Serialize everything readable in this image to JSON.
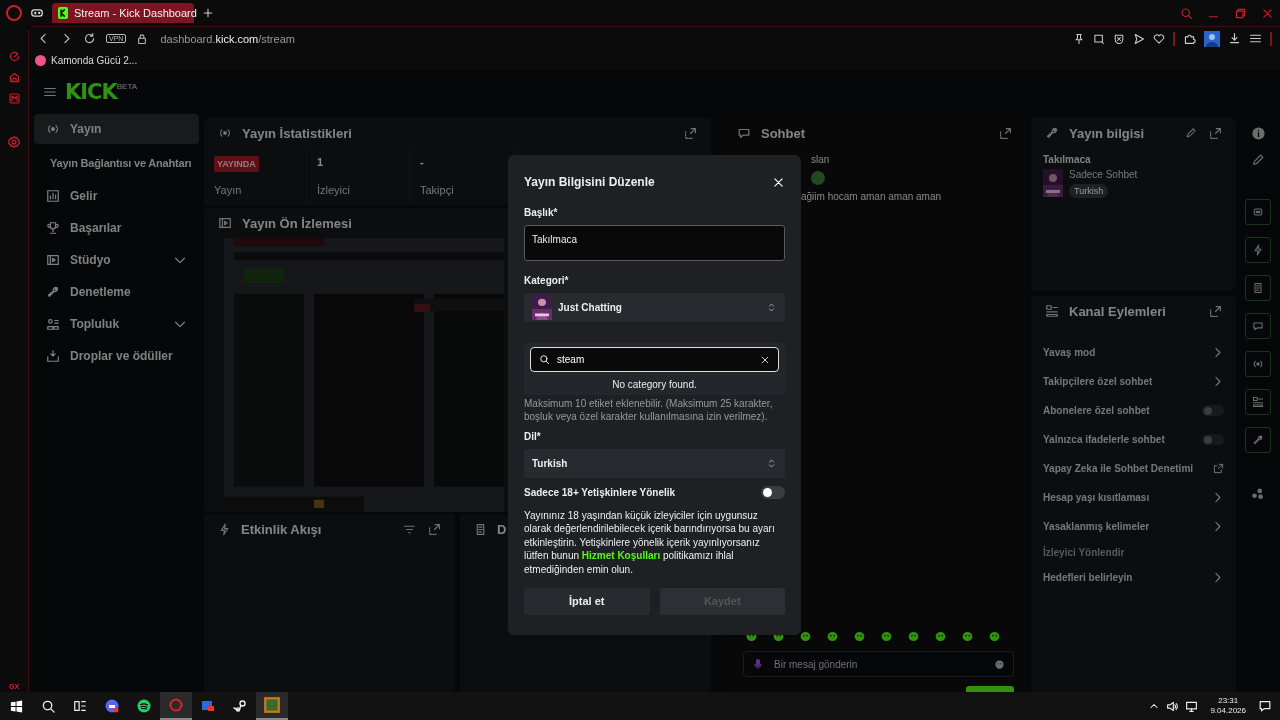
{
  "browser": {
    "tab": {
      "title": "Stream - Kick Dashboard",
      "selected": true
    },
    "vpn_label": "VPN",
    "url": "dashboard.**kick.com**/stream",
    "bookmarks": [
      {
        "label": "Kamonda Gücü 2..."
      }
    ],
    "sidebar_badge": "GX"
  },
  "header": {
    "logo": "KICK",
    "logo_badge": "BETA"
  },
  "nav": {
    "items": [
      {
        "label": "Yayın",
        "kind": "item",
        "selected": true
      },
      {
        "label": "Yayın Bağlantısı ve Anahtarı",
        "kind": "sub",
        "selected": false
      },
      {
        "label": "Gelir",
        "kind": "item",
        "selected": false
      },
      {
        "label": "Başarılar",
        "kind": "item",
        "selected": false
      },
      {
        "label": "Stüdyo",
        "kind": "group",
        "selected": false
      },
      {
        "label": "Denetleme",
        "kind": "item",
        "selected": false
      },
      {
        "label": "Topluluk",
        "kind": "group",
        "selected": false
      },
      {
        "label": "Droplar ve ödüller",
        "kind": "item",
        "selected": false
      }
    ]
  },
  "stats": {
    "title": "Yayın İstatistikleri",
    "cells": [
      {
        "kind": "badge",
        "value": "YAYINDA",
        "label": "Yayın"
      },
      {
        "kind": "number",
        "value": "1",
        "label": "İzleyici"
      },
      {
        "kind": "number",
        "value": "-",
        "label": "Takipçi"
      }
    ]
  },
  "preview": {
    "title": "Yayın Ön İzlemesi",
    "kind": "picture"
  },
  "events": {
    "title": "Etkinlik Akışı"
  },
  "panel_5": {
    "title": "D"
  },
  "chat": {
    "title": "Sohbet",
    "messages": [
      "slan",
      "ağiim hocam aman aman aman"
    ],
    "input": {
      "placeholder": "Bir mesaj gönderin"
    }
  },
  "stream_info": {
    "title": "Yayın bilgisi",
    "stream_title": "Takılmaca",
    "category": "Sadece Sohbet",
    "tag": "Turkish"
  },
  "channel_actions": {
    "title": "Kanal Eylemleri",
    "items": [
      {
        "label": "Yavaş mod",
        "kind": "arrow"
      },
      {
        "label": "Takipçilere özel sohbet",
        "kind": "arrow"
      },
      {
        "label": "Abonelere özel sohbet",
        "kind": "toggle",
        "on": false
      },
      {
        "label": "Yalnızca ifadelerle sohbet",
        "kind": "toggle",
        "on": false
      },
      {
        "label": "Yapay Zeka ile Sohbet Denetimi",
        "kind": "external"
      },
      {
        "label": "Hesap yaşı kısıtlaması",
        "kind": "arrow"
      },
      {
        "label": "Yasaklanmış kelimeler",
        "kind": "arrow"
      },
      {
        "label": "İzleyici Yönlendir",
        "kind": "heading"
      },
      {
        "label": "Hedefleri belirleyin",
        "kind": "arrow"
      }
    ]
  },
  "modal": {
    "title": "Yayın Bilgisini Düzenle",
    "title_label": "Başlık*",
    "title_value": "Takılmaca",
    "category_label": "Kategori*",
    "category": "Just Chatting",
    "category_search": {
      "value": "steam",
      "empty_text": "No category found."
    },
    "tags_hint": "Maksimum 10 etiket eklenebilir. (Maksimum 25 karakter, boşluk veya özel karakter kullanılmasına izin verilmez).",
    "language_label": "Dil*",
    "language": "Turkish",
    "adult": {
      "label": "Sadece 18+ Yetişkinlere Yönelik",
      "on": false
    },
    "notice": {
      "before": "Yayınınız 18 yaşından küçük izleyiciler için uygunsuz olarak değerlendirilebilecek içerik barındırıyorsa bu ayarı etkinleştirin. Yetişkinlere yönelik içerik yayınlıyorsanız lütfen bunun ",
      "link": "Hizmet Koşulları",
      "after": " politikamızı ihlal etmediğinden emin olun."
    },
    "buttons": [
      {
        "label": "İptal et",
        "disabled": false
      },
      {
        "label": "Kaydet",
        "disabled": true
      }
    ]
  },
  "taskbar": {
    "time": "23:31",
    "date": "9.04.2026"
  }
}
